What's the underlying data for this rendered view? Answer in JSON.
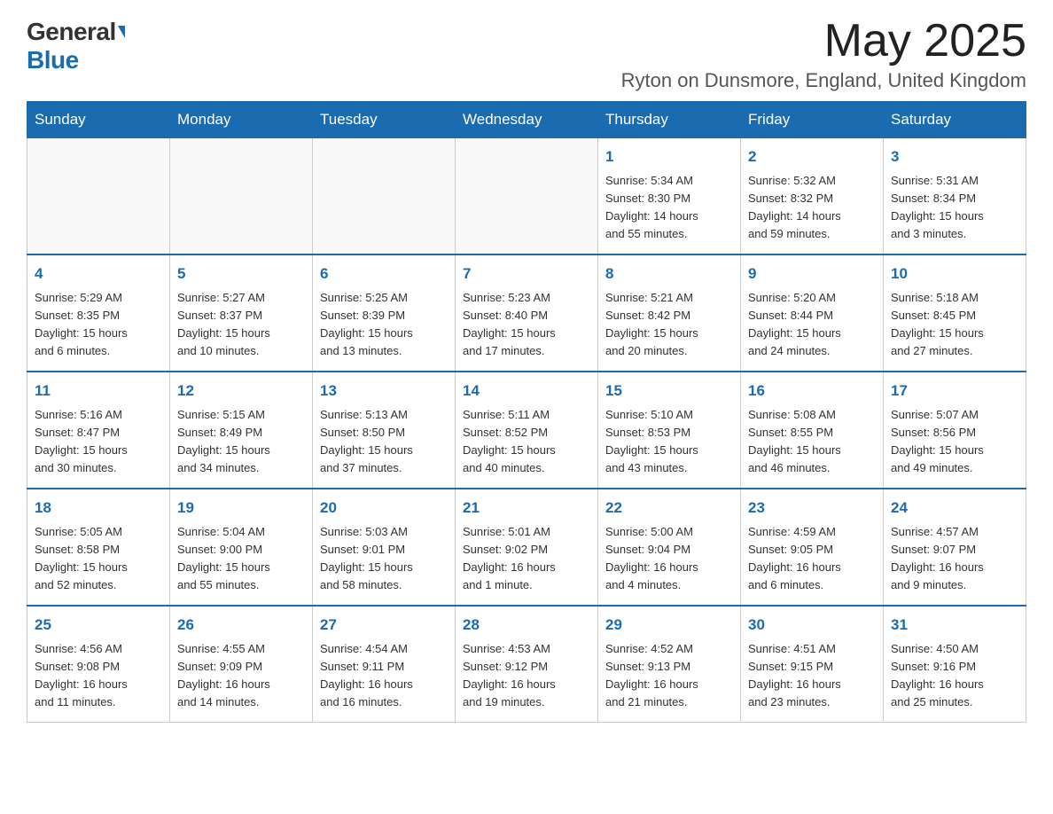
{
  "header": {
    "logo_general": "General",
    "logo_blue": "Blue",
    "month_title": "May 2025",
    "location": "Ryton on Dunsmore, England, United Kingdom"
  },
  "days_of_week": [
    "Sunday",
    "Monday",
    "Tuesday",
    "Wednesday",
    "Thursday",
    "Friday",
    "Saturday"
  ],
  "weeks": [
    [
      {
        "day": "",
        "info": ""
      },
      {
        "day": "",
        "info": ""
      },
      {
        "day": "",
        "info": ""
      },
      {
        "day": "",
        "info": ""
      },
      {
        "day": "1",
        "info": "Sunrise: 5:34 AM\nSunset: 8:30 PM\nDaylight: 14 hours\nand 55 minutes."
      },
      {
        "day": "2",
        "info": "Sunrise: 5:32 AM\nSunset: 8:32 PM\nDaylight: 14 hours\nand 59 minutes."
      },
      {
        "day": "3",
        "info": "Sunrise: 5:31 AM\nSunset: 8:34 PM\nDaylight: 15 hours\nand 3 minutes."
      }
    ],
    [
      {
        "day": "4",
        "info": "Sunrise: 5:29 AM\nSunset: 8:35 PM\nDaylight: 15 hours\nand 6 minutes."
      },
      {
        "day": "5",
        "info": "Sunrise: 5:27 AM\nSunset: 8:37 PM\nDaylight: 15 hours\nand 10 minutes."
      },
      {
        "day": "6",
        "info": "Sunrise: 5:25 AM\nSunset: 8:39 PM\nDaylight: 15 hours\nand 13 minutes."
      },
      {
        "day": "7",
        "info": "Sunrise: 5:23 AM\nSunset: 8:40 PM\nDaylight: 15 hours\nand 17 minutes."
      },
      {
        "day": "8",
        "info": "Sunrise: 5:21 AM\nSunset: 8:42 PM\nDaylight: 15 hours\nand 20 minutes."
      },
      {
        "day": "9",
        "info": "Sunrise: 5:20 AM\nSunset: 8:44 PM\nDaylight: 15 hours\nand 24 minutes."
      },
      {
        "day": "10",
        "info": "Sunrise: 5:18 AM\nSunset: 8:45 PM\nDaylight: 15 hours\nand 27 minutes."
      }
    ],
    [
      {
        "day": "11",
        "info": "Sunrise: 5:16 AM\nSunset: 8:47 PM\nDaylight: 15 hours\nand 30 minutes."
      },
      {
        "day": "12",
        "info": "Sunrise: 5:15 AM\nSunset: 8:49 PM\nDaylight: 15 hours\nand 34 minutes."
      },
      {
        "day": "13",
        "info": "Sunrise: 5:13 AM\nSunset: 8:50 PM\nDaylight: 15 hours\nand 37 minutes."
      },
      {
        "day": "14",
        "info": "Sunrise: 5:11 AM\nSunset: 8:52 PM\nDaylight: 15 hours\nand 40 minutes."
      },
      {
        "day": "15",
        "info": "Sunrise: 5:10 AM\nSunset: 8:53 PM\nDaylight: 15 hours\nand 43 minutes."
      },
      {
        "day": "16",
        "info": "Sunrise: 5:08 AM\nSunset: 8:55 PM\nDaylight: 15 hours\nand 46 minutes."
      },
      {
        "day": "17",
        "info": "Sunrise: 5:07 AM\nSunset: 8:56 PM\nDaylight: 15 hours\nand 49 minutes."
      }
    ],
    [
      {
        "day": "18",
        "info": "Sunrise: 5:05 AM\nSunset: 8:58 PM\nDaylight: 15 hours\nand 52 minutes."
      },
      {
        "day": "19",
        "info": "Sunrise: 5:04 AM\nSunset: 9:00 PM\nDaylight: 15 hours\nand 55 minutes."
      },
      {
        "day": "20",
        "info": "Sunrise: 5:03 AM\nSunset: 9:01 PM\nDaylight: 15 hours\nand 58 minutes."
      },
      {
        "day": "21",
        "info": "Sunrise: 5:01 AM\nSunset: 9:02 PM\nDaylight: 16 hours\nand 1 minute."
      },
      {
        "day": "22",
        "info": "Sunrise: 5:00 AM\nSunset: 9:04 PM\nDaylight: 16 hours\nand 4 minutes."
      },
      {
        "day": "23",
        "info": "Sunrise: 4:59 AM\nSunset: 9:05 PM\nDaylight: 16 hours\nand 6 minutes."
      },
      {
        "day": "24",
        "info": "Sunrise: 4:57 AM\nSunset: 9:07 PM\nDaylight: 16 hours\nand 9 minutes."
      }
    ],
    [
      {
        "day": "25",
        "info": "Sunrise: 4:56 AM\nSunset: 9:08 PM\nDaylight: 16 hours\nand 11 minutes."
      },
      {
        "day": "26",
        "info": "Sunrise: 4:55 AM\nSunset: 9:09 PM\nDaylight: 16 hours\nand 14 minutes."
      },
      {
        "day": "27",
        "info": "Sunrise: 4:54 AM\nSunset: 9:11 PM\nDaylight: 16 hours\nand 16 minutes."
      },
      {
        "day": "28",
        "info": "Sunrise: 4:53 AM\nSunset: 9:12 PM\nDaylight: 16 hours\nand 19 minutes."
      },
      {
        "day": "29",
        "info": "Sunrise: 4:52 AM\nSunset: 9:13 PM\nDaylight: 16 hours\nand 21 minutes."
      },
      {
        "day": "30",
        "info": "Sunrise: 4:51 AM\nSunset: 9:15 PM\nDaylight: 16 hours\nand 23 minutes."
      },
      {
        "day": "31",
        "info": "Sunrise: 4:50 AM\nSunset: 9:16 PM\nDaylight: 16 hours\nand 25 minutes."
      }
    ]
  ]
}
